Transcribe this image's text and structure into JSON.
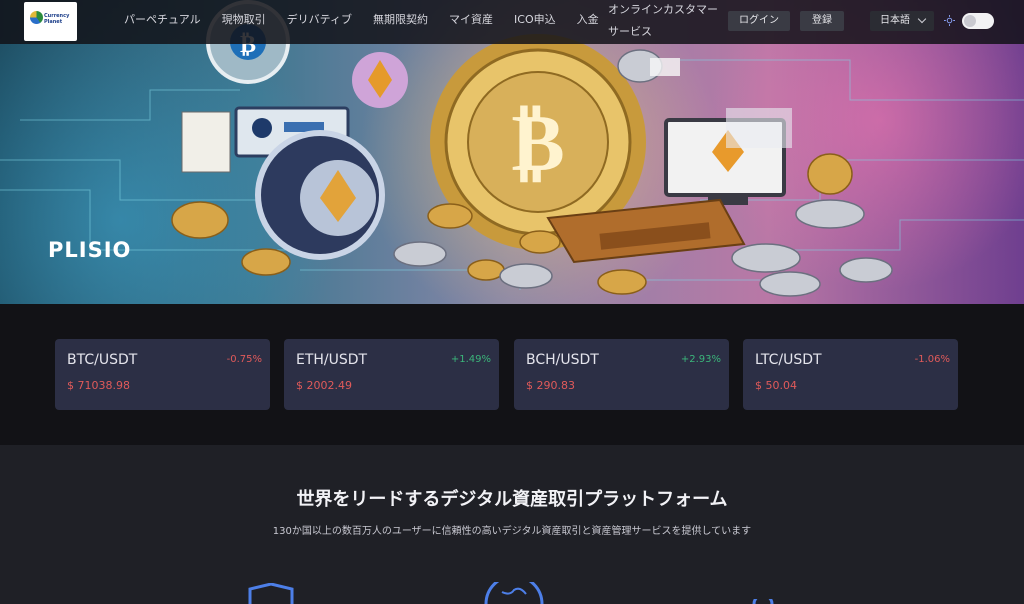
{
  "header": {
    "logo_text": [
      "Currency",
      "Planet"
    ],
    "nav": [
      "パーペチュアル",
      "現物取引",
      "デリバティブ",
      "無期限契約",
      "マイ資産",
      "ICO申込",
      "入金"
    ],
    "customer_service": "オンラインカスタマーサービス",
    "login": "ログイン",
    "register": "登録",
    "language": "日本語"
  },
  "hero": {
    "brand": "PLISIO"
  },
  "tickers": [
    {
      "pair": "BTC/USDT",
      "change": "-0.75%",
      "price": "$ 71038.98",
      "direction": "down"
    },
    {
      "pair": "ETH/USDT",
      "change": "+1.49%",
      "price": "$ 2002.49",
      "direction": "up"
    },
    {
      "pair": "BCH/USDT",
      "change": "+2.93%",
      "price": "$ 290.83",
      "direction": "up"
    },
    {
      "pair": "LTC/USDT",
      "change": "-1.06%",
      "price": "$ 50.04",
      "direction": "down"
    }
  ],
  "platform": {
    "title": "世界をリードするデジタル資産取引プラットフォーム",
    "subtitle": "130か国以上の数百万人のユーザーに信頼性の高いデジタル資産取引と資産管理サービスを提供しています"
  },
  "colors": {
    "up": "#3bb57a",
    "down": "#e05a5a",
    "card": "#2c2f45",
    "icon": "#4d7fe8"
  }
}
